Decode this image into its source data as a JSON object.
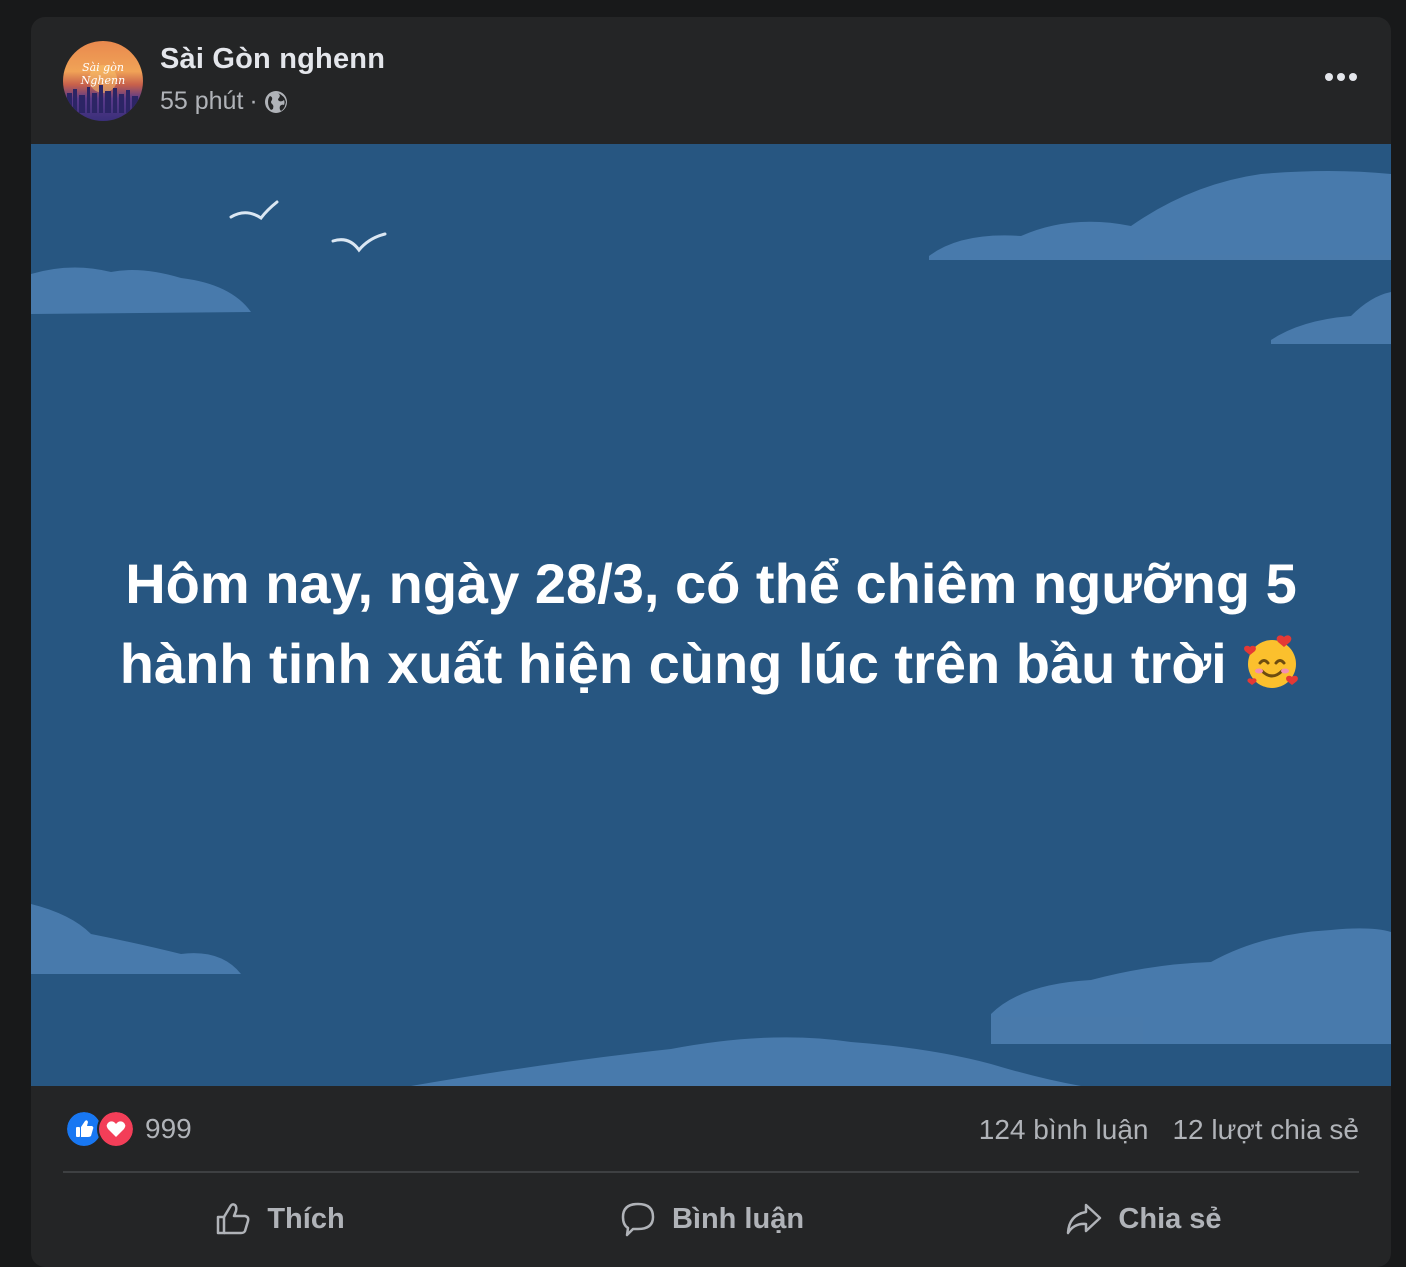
{
  "post": {
    "page_name": "Sài Gòn nghenn",
    "time": "55 phút",
    "separator": "·",
    "audience_icon": "globe-icon",
    "avatar_text": "Sài Gòn Nghenn",
    "more_icon": "more-options-icon"
  },
  "photo": {
    "line1": "Hôm nay, ngày 28/3, có thể chiêm ngưỡng 5",
    "line2": "hành tinh xuất hiện cùng lúc trên bầu trời",
    "emoji": "smiling-face-with-hearts-emoji",
    "background_color": "#275681"
  },
  "stats": {
    "reaction_icons": [
      "like-reaction-icon",
      "love-reaction-icon"
    ],
    "reaction_count": "999",
    "comments": "124 bình luận",
    "shares": "12 lượt chia sẻ"
  },
  "actions": {
    "like": "Thích",
    "comment": "Bình luận",
    "share": "Chia sẻ"
  },
  "colors": {
    "page_bg": "#18191a",
    "card_bg": "#242526",
    "primary_text": "#e4e6eb",
    "secondary_text": "#b0b3b8",
    "like_blue": "#1877f2",
    "love_red": "#f33e58"
  }
}
